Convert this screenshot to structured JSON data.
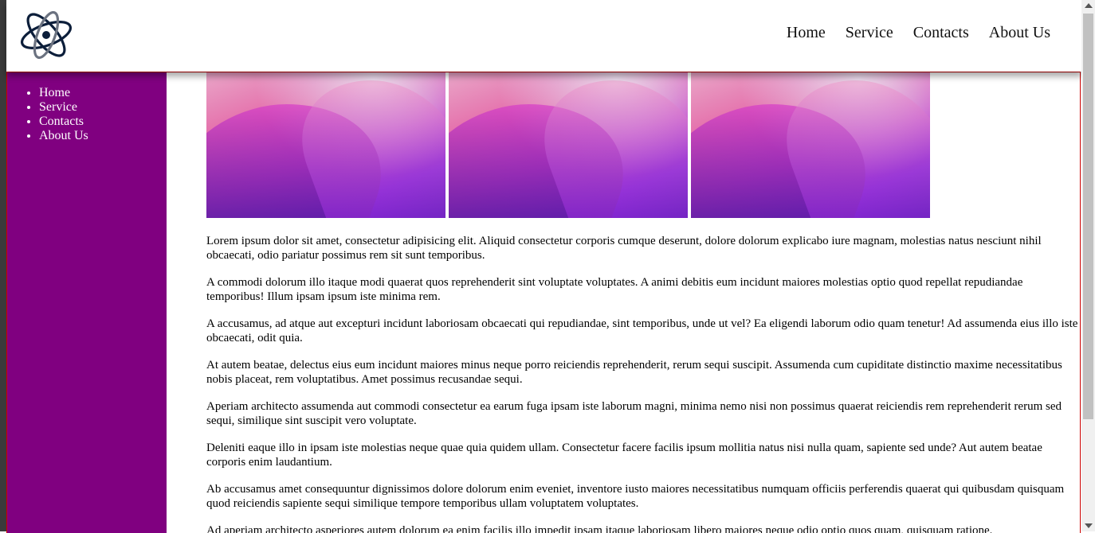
{
  "logo": {
    "icon": "atom-orbit-logo",
    "color": "#0c1e3a"
  },
  "header": {
    "nav": [
      "Home",
      "Service",
      "Contacts",
      "About Us"
    ]
  },
  "sidebar": {
    "items": [
      "Home",
      "Service",
      "Contacts",
      "About Us"
    ]
  },
  "colors": {
    "sidebar_bg": "#800080",
    "frame_border": "#cc0000"
  },
  "gallery": {
    "count": 3,
    "image": "purple-mountain-wallpaper"
  },
  "paragraphs": [
    "Lorem ipsum dolor sit amet, consectetur adipisicing elit. Aliquid consectetur corporis cumque deserunt, dolore dolorum explicabo iure magnam, molestias natus nesciunt nihil obcaecati, odio pariatur possimus rem sit sunt temporibus.",
    "A commodi dolorum illo itaque modi quaerat quos reprehenderit sint voluptate voluptates. A animi debitis eum incidunt maiores molestias optio quod repellat repudiandae temporibus! Illum ipsam ipsum iste minima rem.",
    "A accusamus, ad atque aut excepturi incidunt laboriosam obcaecati qui repudiandae, sint temporibus, unde ut vel? Ea eligendi laborum odio quam tenetur! Ad assumenda eius illo iste obcaecati, odit quia.",
    "At autem beatae, delectus eius eum incidunt maiores minus neque porro reiciendis reprehenderit, rerum sequi suscipit. Assumenda cum cupiditate distinctio maxime necessitatibus nobis placeat, rem voluptatibus. Amet possimus recusandae sequi.",
    "Aperiam architecto assumenda aut commodi consectetur ea earum fuga ipsam iste laborum magni, minima nemo nisi non possimus quaerat reiciendis rem reprehenderit rerum sed sequi, similique sint suscipit vero voluptate.",
    "Deleniti eaque illo in ipsam iste molestias neque quae quia quidem ullam. Consectetur facere facilis ipsum mollitia natus nisi nulla quam, sapiente sed unde? Aut autem beatae corporis enim laudantium.",
    "Ab accusamus amet consequuntur dignissimos dolore dolorum enim eveniet, inventore iusto maiores necessitatibus numquam officiis perferendis quaerat qui quibusdam quisquam quod reiciendis sapiente sequi similique tempore temporibus ullam voluptatem voluptates.",
    "Ad aperiam architecto asperiores autem dolorum ea enim facilis illo impedit ipsam itaque laboriosam libero maiores neque odio optio quos quam, quisquam ratione."
  ]
}
